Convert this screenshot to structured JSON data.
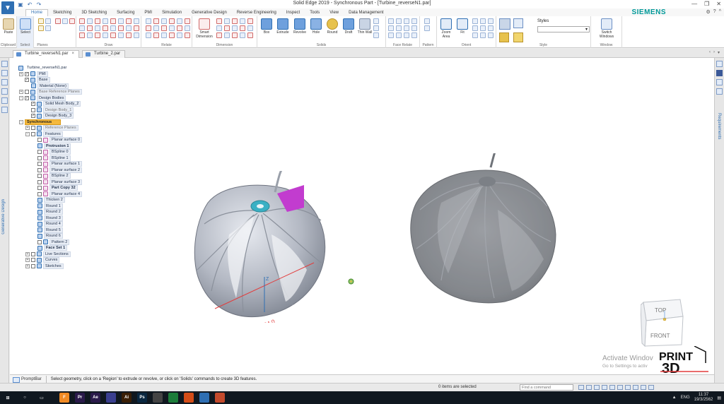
{
  "window": {
    "title": "Solid Edge 2019 - Synchronous Part - [Turbine_reverseN1.par]",
    "brand": "SIEMENS"
  },
  "ribbon": {
    "tabs": [
      "Home",
      "Sketching",
      "3D Sketching",
      "Surfacing",
      "PMI",
      "Simulation",
      "Generative Design",
      "Reverse Engineering",
      "Inspect",
      "Tools",
      "View",
      "Data Management"
    ],
    "active_tab": "Home",
    "groups": {
      "clipboard": {
        "label": "Clipboard",
        "paste": "Paste"
      },
      "select": {
        "label": "Select",
        "select": "Select"
      },
      "planes": {
        "label": "Planes"
      },
      "draw": {
        "label": "Draw"
      },
      "relate": {
        "label": "Relate"
      },
      "dimension": {
        "label": "Dimension",
        "smart_dimension": "Smart Dimension"
      },
      "solids": {
        "label": "Solids",
        "box": "Box",
        "extrude": "Extrude",
        "revolve": "Revolve",
        "hole": "Hole",
        "round": "Round",
        "draft": "Draft",
        "thin_wall": "Thin Wall"
      },
      "face_relate": {
        "label": "Face Relate"
      },
      "pattern": {
        "label": "Pattern"
      },
      "orient": {
        "label": "Orient",
        "zoom_area": "Zoom Area",
        "fit": "Fit"
      },
      "style": {
        "label": "Style",
        "styles": "Styles"
      },
      "window": {
        "label": "Window",
        "switch_windows": "Switch Windows"
      }
    }
  },
  "doc_tabs": [
    {
      "label": "Turbine_reverseN1.par",
      "active": true
    },
    {
      "label": "Turbine_2.par",
      "active": false
    }
  ],
  "side": {
    "left_label": "Generative Design",
    "right_label": "Requirements"
  },
  "tree": [
    {
      "label": "Turbine_reverseN1.par",
      "indent": 0,
      "exp": "",
      "cb": "",
      "icon": "blue",
      "style": "plain"
    },
    {
      "label": "PMI",
      "indent": 1,
      "exp": "+",
      "cb": "✓",
      "icon": "blue",
      "style": ""
    },
    {
      "label": "Base",
      "indent": 1,
      "exp": "",
      "cb": "✓",
      "icon": "blue",
      "style": ""
    },
    {
      "label": "Material (None)",
      "indent": 2,
      "exp": "",
      "cb": "",
      "icon": "blue",
      "style": ""
    },
    {
      "label": "Base Reference Planes",
      "indent": 1,
      "exp": "+",
      "cb": " ",
      "icon": "blue",
      "style": "gray"
    },
    {
      "label": "Design Bodies",
      "indent": 1,
      "exp": "−",
      "cb": "✓",
      "icon": "blue",
      "style": ""
    },
    {
      "label": "Solid Mesh Body_2",
      "indent": 2,
      "exp": "",
      "cb": "✓",
      "icon": "blue",
      "style": ""
    },
    {
      "label": "Design Body_1",
      "indent": 2,
      "exp": "",
      "cb": " ",
      "icon": "blue",
      "style": "gray"
    },
    {
      "label": "Design Body_3",
      "indent": 2,
      "exp": "",
      "cb": "✓",
      "icon": "blue",
      "style": ""
    },
    {
      "label": "Synchronous",
      "indent": 1,
      "exp": "−",
      "cb": "",
      "icon": "",
      "style": "sync"
    },
    {
      "label": "Reference Planes",
      "indent": 2,
      "exp": "+",
      "cb": " ",
      "icon": "blue",
      "style": "gray"
    },
    {
      "label": "Features",
      "indent": 2,
      "exp": "−",
      "cb": " ",
      "icon": "blue",
      "style": ""
    },
    {
      "label": "Planar surface 0",
      "indent": 3,
      "exp": "",
      "cb": " ",
      "icon": "feat",
      "style": ""
    },
    {
      "label": "Protrusion 1",
      "indent": 3,
      "exp": "",
      "cb": "",
      "icon": "blue",
      "style": "bold"
    },
    {
      "label": "BSpline 0",
      "indent": 3,
      "exp": "",
      "cb": " ",
      "icon": "feat",
      "style": ""
    },
    {
      "label": "BSpline 1",
      "indent": 3,
      "exp": "",
      "cb": " ",
      "icon": "feat",
      "style": ""
    },
    {
      "label": "Planar surface 1",
      "indent": 3,
      "exp": "",
      "cb": " ",
      "icon": "feat",
      "style": ""
    },
    {
      "label": "Planar surface 2",
      "indent": 3,
      "exp": "",
      "cb": " ",
      "icon": "feat",
      "style": ""
    },
    {
      "label": "BSpline 2",
      "indent": 3,
      "exp": "",
      "cb": " ",
      "icon": "feat",
      "style": ""
    },
    {
      "label": "Planar surface 3",
      "indent": 3,
      "exp": "",
      "cb": " ",
      "icon": "feat",
      "style": ""
    },
    {
      "label": "Part Copy 32",
      "indent": 3,
      "exp": "",
      "cb": " ",
      "icon": "feat",
      "style": "bold"
    },
    {
      "label": "Planar surface 4",
      "indent": 3,
      "exp": "",
      "cb": " ",
      "icon": "feat",
      "style": ""
    },
    {
      "label": "Thicken 2",
      "indent": 3,
      "exp": "",
      "cb": "",
      "icon": "blue",
      "style": ""
    },
    {
      "label": "Round 1",
      "indent": 3,
      "exp": "",
      "cb": "",
      "icon": "blue",
      "style": ""
    },
    {
      "label": "Round 2",
      "indent": 3,
      "exp": "",
      "cb": "",
      "icon": "blue",
      "style": ""
    },
    {
      "label": "Round 3",
      "indent": 3,
      "exp": "",
      "cb": "",
      "icon": "blue",
      "style": ""
    },
    {
      "label": "Round 4",
      "indent": 3,
      "exp": "",
      "cb": "",
      "icon": "blue",
      "style": ""
    },
    {
      "label": "Round 5",
      "indent": 3,
      "exp": "",
      "cb": "",
      "icon": "blue",
      "style": ""
    },
    {
      "label": "Round 6",
      "indent": 3,
      "exp": "",
      "cb": "",
      "icon": "blue",
      "style": ""
    },
    {
      "label": "Pattern 2",
      "indent": 3,
      "exp": "",
      "cb": " ",
      "icon": "blue",
      "style": ""
    },
    {
      "label": "Face Set 1",
      "indent": 3,
      "exp": "",
      "cb": "",
      "icon": "blue",
      "style": "bold"
    },
    {
      "label": "Live Sections",
      "indent": 2,
      "exp": "+",
      "cb": " ",
      "icon": "blue",
      "style": ""
    },
    {
      "label": "Curves",
      "indent": 2,
      "exp": "+",
      "cb": " ",
      "icon": "blue",
      "style": ""
    },
    {
      "label": "Sketches",
      "indent": 2,
      "exp": "+",
      "cb": " ",
      "icon": "blue",
      "style": ""
    }
  ],
  "viewcube": {
    "top": "TOP",
    "front": "FRONT"
  },
  "watermark": {
    "title": "Activate Windov",
    "subtitle": "Go to Settings to activ"
  },
  "logo": {
    "line1": "PRINT",
    "line2": "3D"
  },
  "promptbar": {
    "label": "PromptBar",
    "message": "Select geometry, click on a 'Region' to extrude or revolve, or click on 'Solids' commands to create 3D features."
  },
  "status": {
    "selection": "0 items are selected",
    "find_placeholder": "Find a command"
  },
  "taskbar": {
    "apps": [
      {
        "label": "F",
        "color": "#f08a24"
      },
      {
        "label": "Pr",
        "color": "#2a1a4a"
      },
      {
        "label": "Ae",
        "color": "#2a1a4a"
      },
      {
        "label": "",
        "color": "#3a3f8f"
      },
      {
        "label": "Ai",
        "color": "#3a1f06"
      },
      {
        "label": "Ps",
        "color": "#0a2740"
      },
      {
        "label": "",
        "color": "#444"
      },
      {
        "label": "",
        "color": "#1c7d3a"
      },
      {
        "label": "",
        "color": "#d44d18"
      },
      {
        "label": "",
        "color": "#2f6fb3"
      },
      {
        "label": "",
        "color": "#c34a2c"
      }
    ],
    "language": "ENG",
    "time": "11:37",
    "date": "19/3/2562"
  },
  "colors": {
    "accent": "#2f6fb3",
    "synchronous": "#f5b93d",
    "highlight_face": "#c23ccf",
    "hub_face": "#3ab0c4",
    "dimension": "#e23c3c"
  }
}
